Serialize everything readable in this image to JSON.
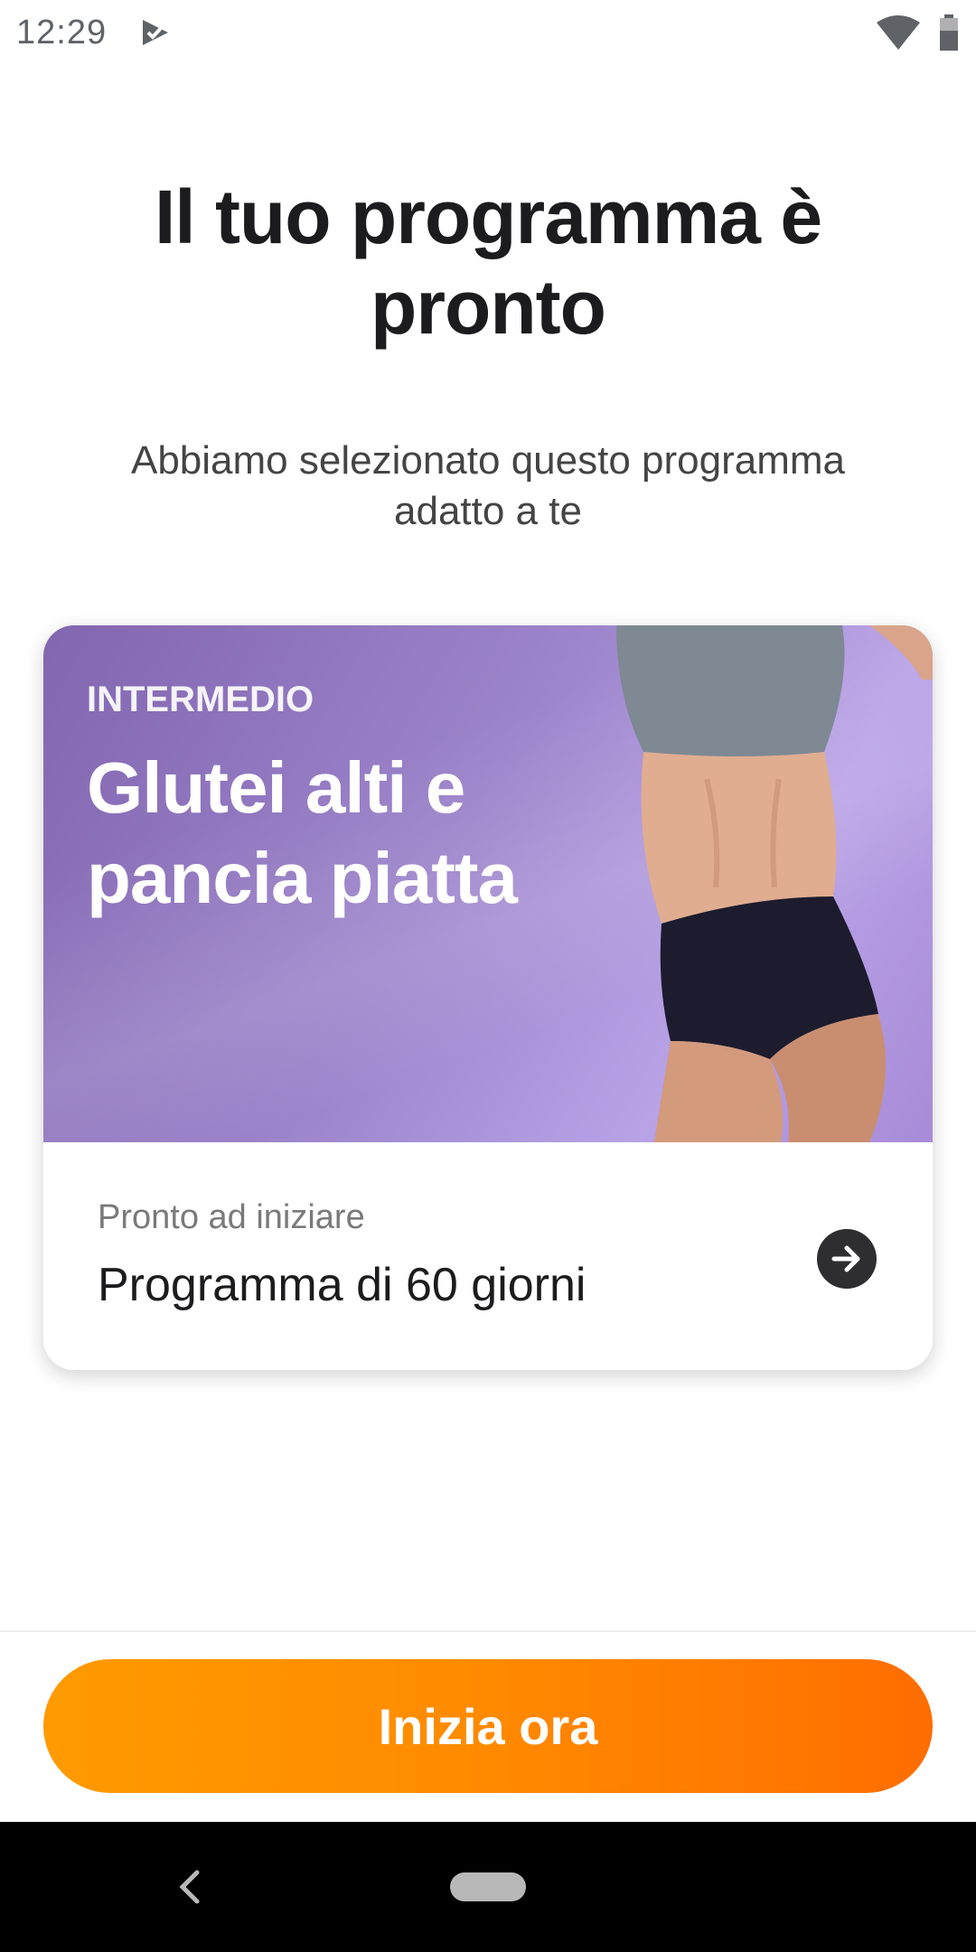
{
  "status_bar": {
    "time": "12:29",
    "icons": [
      "play-store-notification-icon",
      "wifi-icon",
      "battery-icon"
    ]
  },
  "header": {
    "title": "Il tuo programma è pronto",
    "subtitle": "Abbiamo selezionato questo programma adatto a te"
  },
  "program_card": {
    "level": "INTERMEDIO",
    "title": "Glutei alti e pancia piatta",
    "caption": "Pronto ad iniziare",
    "program_name": "Programma di 60 giorni",
    "hero_color": "#9c84cb",
    "action_icon": "arrow-right-circle-icon"
  },
  "cta": {
    "label": "Inizia ora",
    "gradient_start": "#ff9a00",
    "gradient_end": "#ff6d00"
  },
  "nav_bar": {
    "icons": [
      "back-icon",
      "home-pill-icon"
    ]
  }
}
